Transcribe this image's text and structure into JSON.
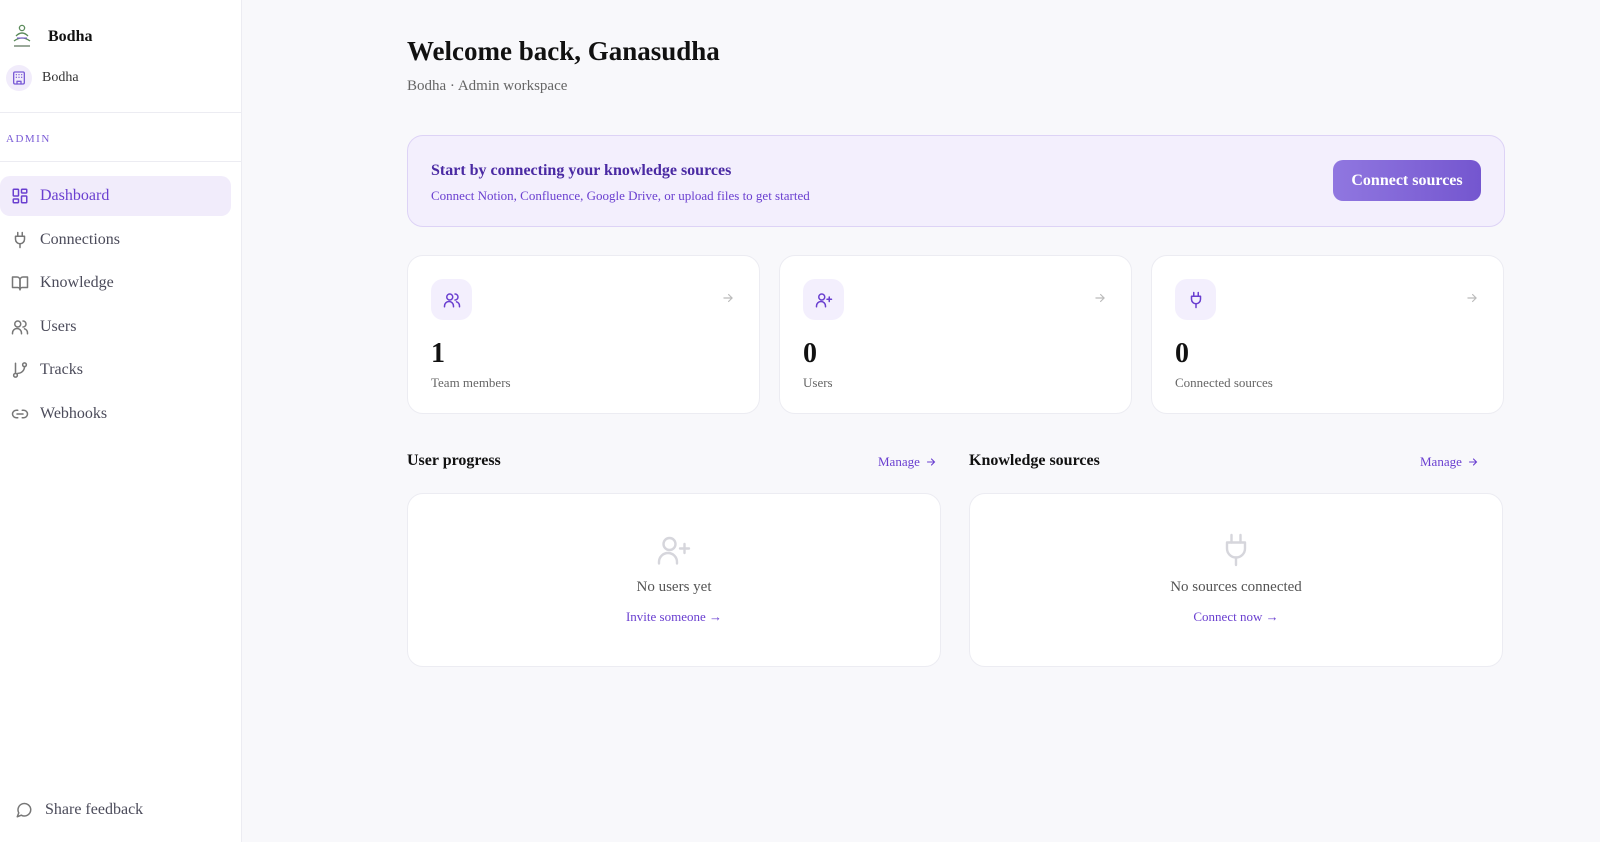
{
  "brand": {
    "name": "Bodha"
  },
  "workspace": {
    "name": "Bodha"
  },
  "sidebar": {
    "section_label": "ADMIN",
    "items": [
      {
        "label": "Dashboard",
        "icon": "dashboard-icon",
        "active": true
      },
      {
        "label": "Connections",
        "icon": "plug-icon"
      },
      {
        "label": "Knowledge",
        "icon": "book-icon"
      },
      {
        "label": "Users",
        "icon": "users-icon"
      },
      {
        "label": "Tracks",
        "icon": "git-branch-icon"
      },
      {
        "label": "Webhooks",
        "icon": "link-icon"
      }
    ],
    "feedback_label": "Share feedback"
  },
  "header": {
    "title": "Welcome back, Ganasudha",
    "subtitle": "Bodha · Admin workspace"
  },
  "banner": {
    "title": "Start by connecting your knowledge sources",
    "description": "Connect Notion, Confluence, Google Drive, or upload files to get started",
    "button_label": "Connect sources"
  },
  "stats": [
    {
      "value": "1",
      "label": "Team members",
      "icon": "users-icon"
    },
    {
      "value": "0",
      "label": "Users",
      "icon": "user-plus-icon"
    },
    {
      "value": "0",
      "label": "Connected sources",
      "icon": "plug-icon"
    }
  ],
  "user_progress": {
    "title": "User progress",
    "manage_label": "Manage",
    "empty_text": "No users yet",
    "cta_label": "Invite someone →"
  },
  "knowledge_sources": {
    "title": "Knowledge sources",
    "manage_label": "Manage",
    "empty_text": "No sources connected",
    "cta_label": "Connect now →"
  },
  "colors": {
    "accent": "#6a3fd0",
    "accent_light": "#f3effd",
    "button_gradient_start": "#9077e0",
    "button_gradient_end": "#7456cf"
  }
}
